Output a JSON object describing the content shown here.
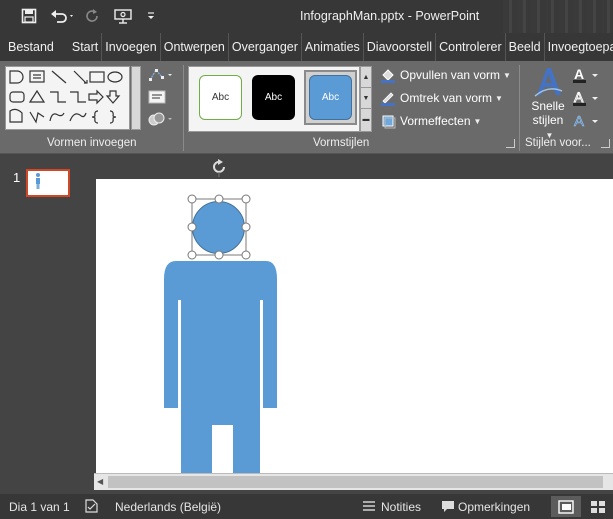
{
  "window": {
    "title": "InfographMan.pptx - PowerPoint",
    "quick_access": [
      "save-icon",
      "undo-icon",
      "redo-icon",
      "present-from-start-icon",
      "customize-qat-icon"
    ]
  },
  "tabs": [
    {
      "label": "Bestand"
    },
    {
      "label": "Start"
    },
    {
      "label": "Invoegen"
    },
    {
      "label": "Ontwerpen"
    },
    {
      "label": "Overganger"
    },
    {
      "label": "Animaties"
    },
    {
      "label": "Diavoorstell"
    },
    {
      "label": "Controlerer"
    },
    {
      "label": "Beeld"
    },
    {
      "label": "Invoegtoepa"
    }
  ],
  "ribbon": {
    "insert_shapes_label": "Vormen invoegen",
    "shape_styles_label": "Vormstijlen",
    "wordart_label": "Stijlen voor...",
    "style_swatches": [
      "Abc",
      "Abc",
      "Abc"
    ],
    "fill_label": "Opvullen van vorm",
    "outline_label": "Omtrek van vorm",
    "effects_label": "Vormeffecten",
    "quick_styles_line1": "Snelle",
    "quick_styles_line2": "stijlen",
    "colors": {
      "fill_accent": "#5b9bd5",
      "outline_accent": "#4472c4"
    }
  },
  "thumbnails": {
    "slide_number": "1"
  },
  "canvas": {
    "figure_color": "#5b9bd5"
  },
  "status": {
    "slide_info": "Dia 1 van 1",
    "language": "Nederlands (België)",
    "notes_label": "Notities",
    "comments_label": "Opmerkingen"
  }
}
